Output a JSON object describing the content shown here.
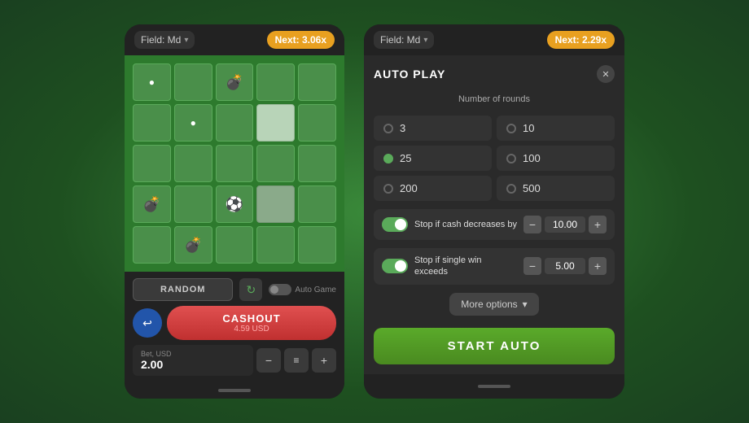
{
  "left_phone": {
    "top_bar": {
      "field_label": "Field: Md",
      "next_label": "Next: 3.06x",
      "chevron": "▾"
    },
    "grid": [
      [
        "white_dot",
        "empty",
        "bomb",
        "empty",
        "empty"
      ],
      [
        "empty",
        "white_dot",
        "empty",
        "revealed",
        "empty"
      ],
      [
        "empty",
        "empty",
        "empty",
        "empty",
        "empty"
      ],
      [
        "bomb",
        "empty",
        "soccer",
        "revealed",
        "empty"
      ],
      [
        "empty",
        "bomb",
        "empty",
        "empty",
        "empty"
      ]
    ],
    "controls": {
      "random_label": "RANDOM",
      "auto_game_label": "Auto Game",
      "cashout_label": "CASHOUT",
      "cashout_sub": "4.59 USD",
      "bet_label": "Bet, USD",
      "bet_value": "2.00"
    }
  },
  "right_phone": {
    "top_bar": {
      "field_label": "Field: Md",
      "next_label": "Next: 2.29x",
      "chevron": "▾"
    },
    "autoplay": {
      "title": "AUTO PLAY",
      "close": "✕",
      "rounds_label": "Number of rounds",
      "rounds": [
        {
          "value": "3",
          "selected": false
        },
        {
          "value": "10",
          "selected": false
        },
        {
          "value": "25",
          "selected": true
        },
        {
          "value": "100",
          "selected": false
        },
        {
          "value": "200",
          "selected": false
        },
        {
          "value": "500",
          "selected": false
        }
      ],
      "option1_label": "Stop if cash decreases by",
      "option1_value": "10.00",
      "option2_label": "Stop if single win exceeds",
      "option2_value": "5.00",
      "more_options_label": "More options",
      "start_auto_label": "START AUTO"
    }
  },
  "icons": {
    "bomb": "💣",
    "soccer": "⚽",
    "dot": "●",
    "refresh": "↻",
    "back": "↩",
    "stack": "≡",
    "chevron_down": "▾"
  }
}
